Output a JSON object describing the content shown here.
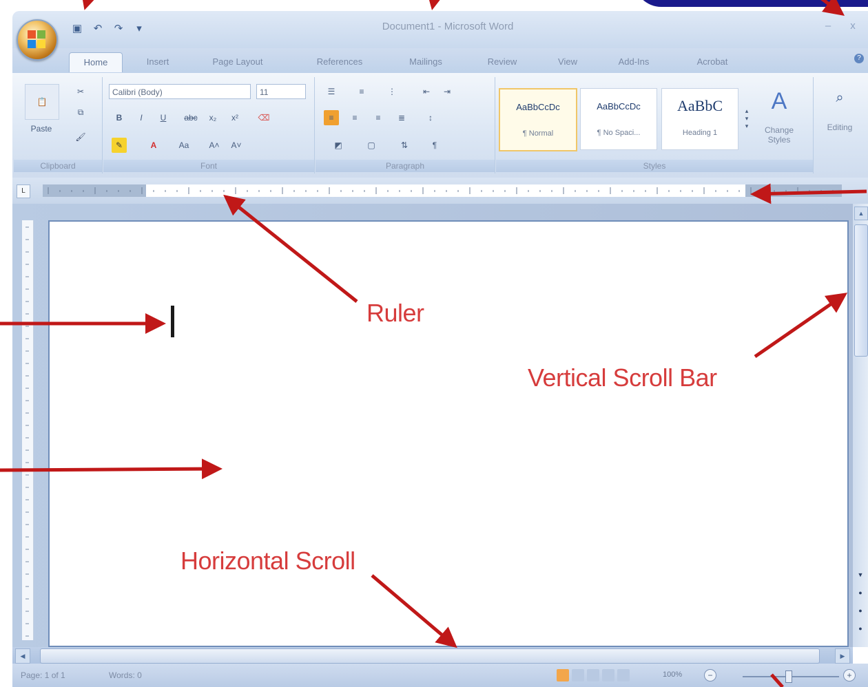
{
  "window": {
    "title": "Document1 - Microsoft Word",
    "buttons": [
      "–",
      "x"
    ]
  },
  "quick_access": [
    {
      "icon": "save-icon",
      "glyph": "▣"
    },
    {
      "icon": "undo-icon",
      "glyph": "↶"
    },
    {
      "icon": "redo-icon",
      "glyph": "↷"
    },
    {
      "icon": "customize-icon",
      "glyph": "▾"
    }
  ],
  "tabs": [
    "Home",
    "Insert",
    "Page Layout",
    "References",
    "Mailings",
    "Review",
    "View",
    "Add-Ins",
    "Acrobat"
  ],
  "active_tab": "Home",
  "ribbon": {
    "clipboard": {
      "label": "Clipboard",
      "paste": "Paste"
    },
    "font": {
      "label": "Font",
      "name": "Calibri (Body)",
      "size": "11"
    },
    "paragraph": {
      "label": "Paragraph"
    },
    "styles": {
      "label": "Styles",
      "items": [
        {
          "preview": "AaBbCcDc",
          "name": "¶ Normal"
        },
        {
          "preview": "AaBbCcDc",
          "name": "¶ No Spaci..."
        },
        {
          "preview": "AaBbC",
          "name": "Heading 1"
        }
      ],
      "change_styles": "Change Styles"
    },
    "editing": {
      "label": "Editing"
    }
  },
  "annotations": {
    "ruler": "Ruler",
    "vertical_scroll": "Vertical Scroll Bar",
    "horizontal_scroll": "Horizontal Scroll"
  },
  "status": {
    "page": "Page: 1 of 1",
    "words": "Words: 0",
    "zoom": "100%"
  },
  "colors": {
    "annotation": "#d63c3c",
    "arrow": "#c01818",
    "ribbon": "#dbe6f4",
    "page_border": "#6f8db9"
  }
}
